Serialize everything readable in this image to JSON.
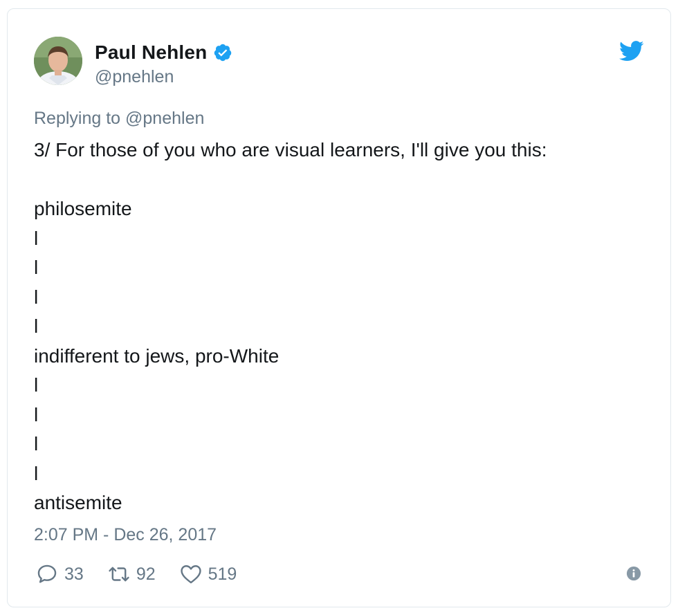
{
  "author": {
    "display_name": "Paul Nehlen",
    "handle": "@pnehlen",
    "verified": true
  },
  "reply_context": "Replying to @pnehlen",
  "tweet": {
    "lines": [
      "3/ For those of you who are visual learners, I'll give you this:",
      "",
      "philosemite",
      "l",
      "l",
      "l",
      "l",
      "indifferent to jews, pro-White",
      "l",
      "l",
      "l",
      "l",
      "antisemite"
    ]
  },
  "timestamp": "2:07 PM - Dec 26, 2017",
  "actions": {
    "replies": "33",
    "retweets": "92",
    "likes": "519"
  },
  "icons": {
    "verified": "verified-badge-icon",
    "brand": "twitter-bird-icon",
    "reply": "reply-icon",
    "retweet": "retweet-icon",
    "like": "heart-icon",
    "info": "info-icon"
  },
  "colors": {
    "brand_blue": "#1da1f2",
    "text_primary": "#14171a",
    "text_secondary": "#657786",
    "border": "#e1e8ed"
  }
}
